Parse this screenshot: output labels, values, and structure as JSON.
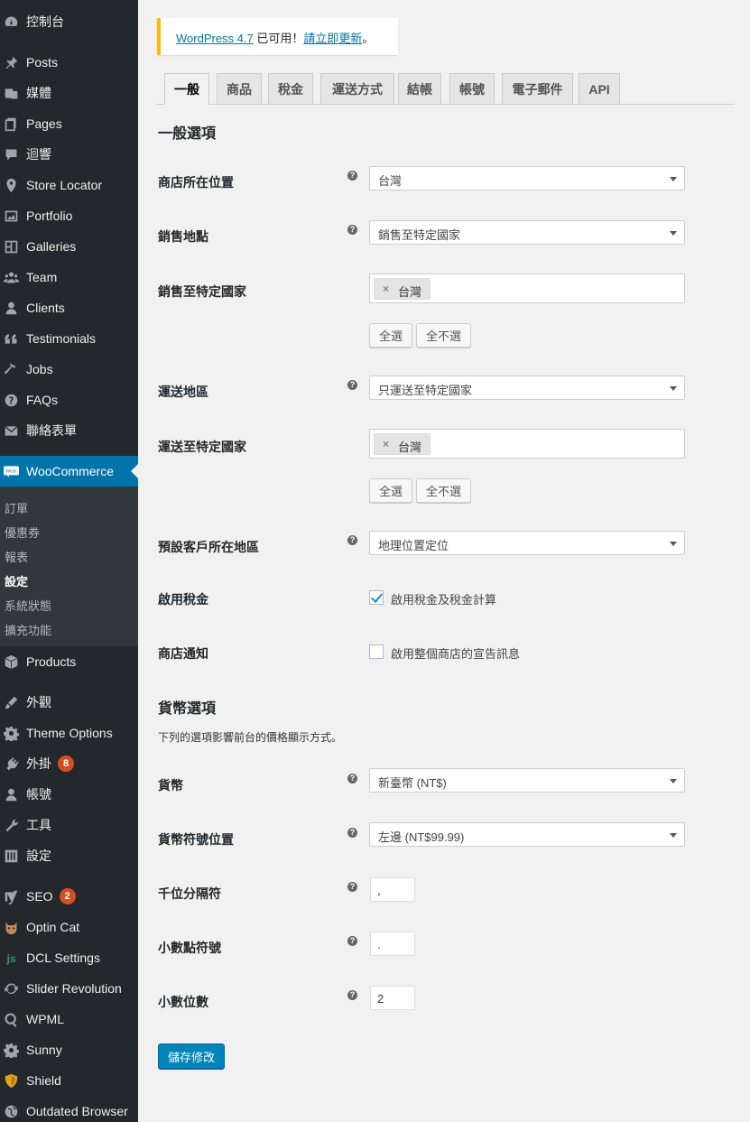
{
  "sidebar": {
    "items": [
      {
        "label": "控制台",
        "icon": "dashboard-icon"
      },
      {
        "label": "Posts",
        "icon": "pin-icon"
      },
      {
        "label": "媒體",
        "icon": "media-icon"
      },
      {
        "label": "Pages",
        "icon": "pages-icon"
      },
      {
        "label": "迴響",
        "icon": "comments-icon"
      },
      {
        "label": "Store Locator",
        "icon": "location-icon"
      },
      {
        "label": "Portfolio",
        "icon": "portfolio-icon"
      },
      {
        "label": "Galleries",
        "icon": "gallery-icon"
      },
      {
        "label": "Team",
        "icon": "team-icon"
      },
      {
        "label": "Clients",
        "icon": "clients-icon"
      },
      {
        "label": "Testimonials",
        "icon": "quote-icon"
      },
      {
        "label": "Jobs",
        "icon": "hammer-icon"
      },
      {
        "label": "FAQs",
        "icon": "help-icon"
      },
      {
        "label": "聯絡表單",
        "icon": "mail-icon"
      },
      {
        "label": "WooCommerce",
        "icon": "woo-icon"
      },
      {
        "label": "Products",
        "icon": "products-icon"
      },
      {
        "label": "外觀",
        "icon": "appearance-icon"
      },
      {
        "label": "Theme Options",
        "icon": "gear-icon"
      },
      {
        "label": "外掛",
        "icon": "plugin-icon",
        "badge": "8"
      },
      {
        "label": "帳號",
        "icon": "user-icon"
      },
      {
        "label": "工具",
        "icon": "wrench-icon"
      },
      {
        "label": "設定",
        "icon": "settings-icon"
      },
      {
        "label": "SEO",
        "icon": "yoast-icon",
        "badge": "2"
      },
      {
        "label": "Optin Cat",
        "icon": "cat-icon"
      },
      {
        "label": "DCL Settings",
        "icon": "js-icon"
      },
      {
        "label": "Slider Revolution",
        "icon": "refresh-icon"
      },
      {
        "label": "WPML",
        "icon": "wpml-icon"
      },
      {
        "label": "Sunny",
        "icon": "gear-icon"
      },
      {
        "label": "Shield",
        "icon": "shield-icon"
      },
      {
        "label": "Outdated Browser",
        "icon": "globe-icon"
      }
    ],
    "submenu": [
      "訂單",
      "優惠券",
      "報表",
      "設定",
      "系統狀態",
      "擴充功能"
    ],
    "submenu_current": "設定",
    "woo_icon_text": "Woo"
  },
  "notice": {
    "link1": "WordPress 4.7",
    "text": " 已可用！",
    "link2": "請立即更新",
    "end": "。"
  },
  "tabs": [
    "一般",
    "商品",
    "稅金",
    "運送方式",
    "結帳",
    "帳號",
    "電子郵件",
    "API"
  ],
  "general": {
    "title": "一般選項",
    "store_location_label": "商店所在位置",
    "store_location_value": "台灣",
    "selling_location_label": "銷售地點",
    "selling_location_value": "銷售至特定國家",
    "specific_countries_label": "銷售至特定國家",
    "specific_countries_chip": "台灣",
    "select_all": "全選",
    "select_none": "全不選",
    "shipping_location_label": "運送地區",
    "shipping_location_value": "只運送至特定國家",
    "ship_specific_label": "運送至特定國家",
    "ship_specific_chip": "台灣",
    "default_customer_label": "預設客戶所在地區",
    "default_customer_value": "地理位置定位",
    "enable_tax_label": "啟用稅金",
    "enable_tax_text": "啟用稅金及稅金計算",
    "enable_tax_checked": true,
    "store_notice_label": "商店通知",
    "store_notice_text": "啟用整個商店的宣告訊息",
    "store_notice_checked": false
  },
  "currency": {
    "title": "貨幣選項",
    "description": "下列的選項影響前台的價格顯示方式。",
    "currency_label": "貨幣",
    "currency_value": "新臺幣 (NT$)",
    "position_label": "貨幣符號位置",
    "position_value": "左邊 (NT$99.99)",
    "thousand_label": "千位分隔符",
    "thousand_value": ",",
    "decimal_label": "小數點符號",
    "decimal_value": ".",
    "decimals_label": "小數位數",
    "decimals_value": "2"
  },
  "save_label": "儲存修改",
  "help_glyph": "?",
  "chip_remove": "×",
  "colors": {
    "sidebar_bg": "#23282d",
    "active": "#0073aa",
    "notice": "#ffb900",
    "primary_button": "#0085ba",
    "badge": "#d54e21"
  }
}
